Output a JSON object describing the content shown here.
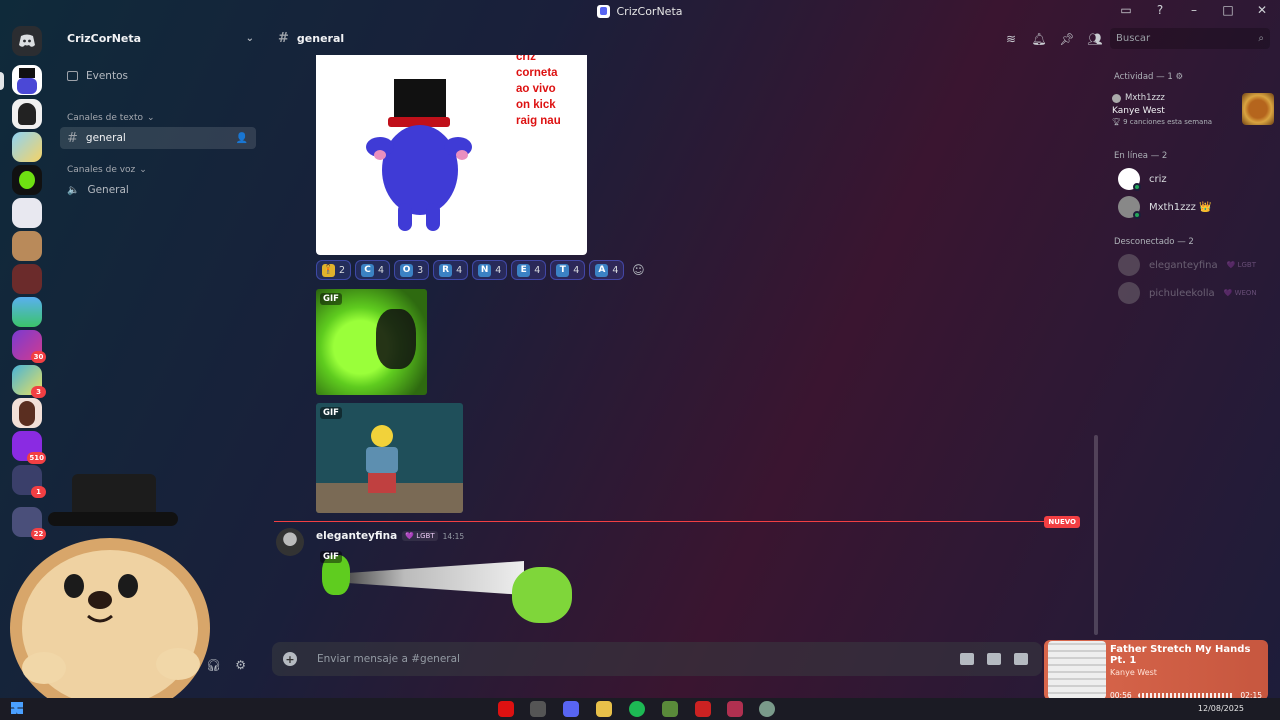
{
  "window": {
    "title": "CrizCorNeta"
  },
  "server": {
    "name": "CrizCorNeta",
    "events_label": "Eventos",
    "text_category": "Canales de texto",
    "text_channel": "general",
    "voice_category": "Canales de voz",
    "voice_channel": "General",
    "badges": [
      "30",
      "3",
      "510",
      "1",
      "22"
    ]
  },
  "channel": {
    "name": "general",
    "search_placeholder": "Buscar"
  },
  "chat": {
    "image_text": [
      "criz",
      "corneta",
      "ao vivo",
      "on kick",
      "raig nau"
    ],
    "reactions": [
      {
        "label": "",
        "count": "2",
        "color": "#e0b22c"
      },
      {
        "label": "C",
        "count": "4",
        "color": "#3b82c4"
      },
      {
        "label": "O",
        "count": "3",
        "color": "#3b82c4"
      },
      {
        "label": "R",
        "count": "4",
        "color": "#3b82c4"
      },
      {
        "label": "N",
        "count": "4",
        "color": "#3b82c4"
      },
      {
        "label": "E",
        "count": "4",
        "color": "#3b82c4"
      },
      {
        "label": "T",
        "count": "4",
        "color": "#3b82c4"
      },
      {
        "label": "A",
        "count": "4",
        "color": "#3b82c4"
      }
    ],
    "gif_label": "GIF",
    "new_label": "NUEVO",
    "message": {
      "author": "eleganteyfina",
      "tag": "💜 LGBT",
      "time": "14:15"
    },
    "composer_placeholder": "Enviar mensaje a #general"
  },
  "members": {
    "activity_header": "Actividad — 1",
    "activity_user": "Mxth1zzz",
    "activity_artist": "Kanye West",
    "activity_detail": "9 canciones esta semana",
    "online_header": "En línea — 2",
    "online": [
      {
        "name": "criz"
      },
      {
        "name": "Mxth1zzz 👑"
      }
    ],
    "offline_header": "Desconectado — 2",
    "offline": [
      {
        "name": "eleganteyfina",
        "tag": "💜 LGBT"
      },
      {
        "name": "pichuleekolla",
        "tag": "💜 WEON"
      }
    ]
  },
  "now_playing": {
    "track": "Father Stretch My Hands Pt. 1",
    "artist": "Kanye West",
    "elapsed": "00:56",
    "duration": "02:15",
    "progress": 0.41
  },
  "taskbar": {
    "date": "12/08/2025"
  },
  "colors": {
    "accent": "#5865f2",
    "new_line": "#f23f43",
    "online": "#23a55a"
  }
}
